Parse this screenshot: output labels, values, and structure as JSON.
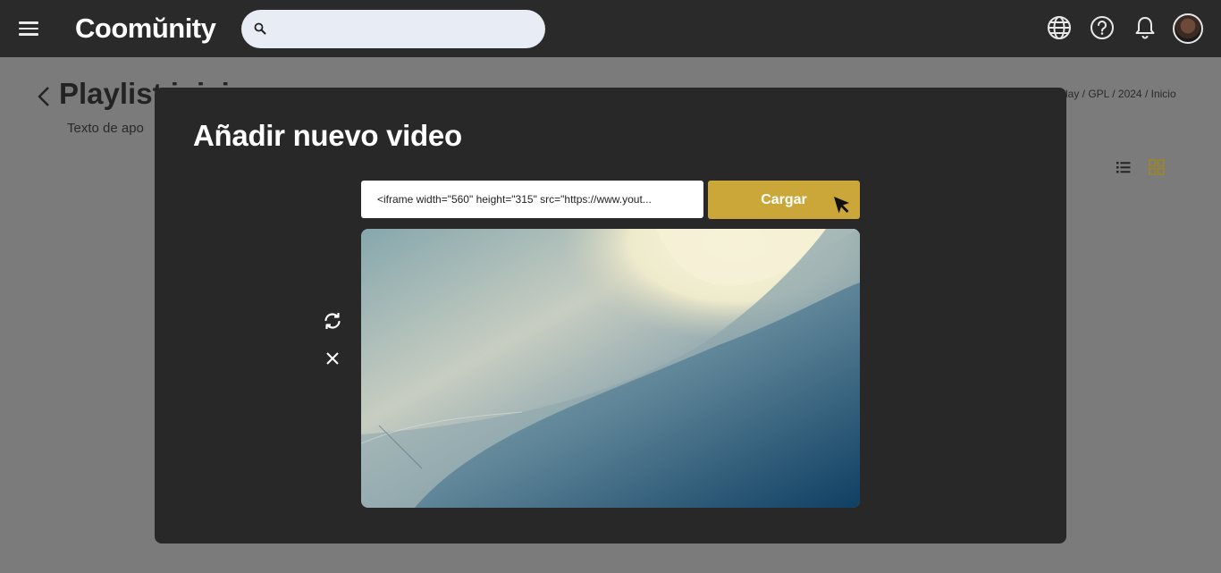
{
  "header": {
    "logo_text": "Coomŭnity",
    "search_placeholder": "",
    "icons": [
      "menu-icon",
      "globe-icon",
      "help-icon",
      "bell-icon",
      "avatar"
    ]
  },
  "page": {
    "title": "Playlist inici",
    "subtitle": "Texto de apo",
    "breadcrumb": "lay / GPL / 2024 / Inicio",
    "view_icons": [
      "list-view-icon",
      "grid-view-icon"
    ]
  },
  "modal": {
    "title": "Añadir nuevo video",
    "url_value": "<iframe width=\"560\" height=\"315\" src=\"https://www.yout...",
    "load_label": "Cargar",
    "side_icons": [
      "refresh-icon",
      "close-icon"
    ]
  },
  "colors": {
    "accent": "#cba73a",
    "topbar": "#2a2a2a",
    "modal_bg": "#282828",
    "overlay_page": "#7b7b7b"
  }
}
